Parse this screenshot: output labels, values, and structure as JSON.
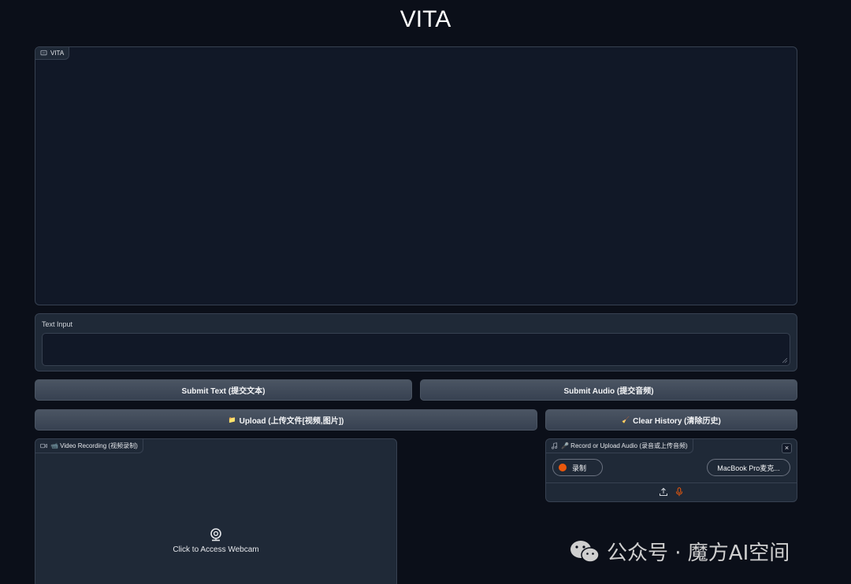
{
  "app": {
    "title": "VITA"
  },
  "chatbot": {
    "label": "VITA"
  },
  "text_input": {
    "label": "Text Input",
    "value": "",
    "placeholder": ""
  },
  "buttons": {
    "submit_text": "Submit Text (提交文本)",
    "submit_audio": "Submit Audio (提交音频)",
    "upload": "Upload (上传文件[视频,图片])",
    "clear_history": "Clear History (清除历史)"
  },
  "video": {
    "label": "📹 Video Recording (视频录制)",
    "webcam_prompt": "Click to Access Webcam"
  },
  "audio": {
    "label": "🎤 Record or Upload Audio (录音或上传音频)",
    "record_label": "录制",
    "device": "MacBook Pro麦克...",
    "close": "×"
  },
  "watermark": {
    "text": "公众号 · 魔方AI空间"
  },
  "colors": {
    "background": "#0b0f19",
    "panel": "#1f2937",
    "border": "#374151",
    "record_accent": "#ea580c"
  },
  "icons": [
    "chat-icon",
    "folder-icon",
    "broom-icon",
    "video-camera-icon",
    "webcam-icon",
    "music-note-icon",
    "upload-icon",
    "microphone-icon",
    "close-icon"
  ]
}
